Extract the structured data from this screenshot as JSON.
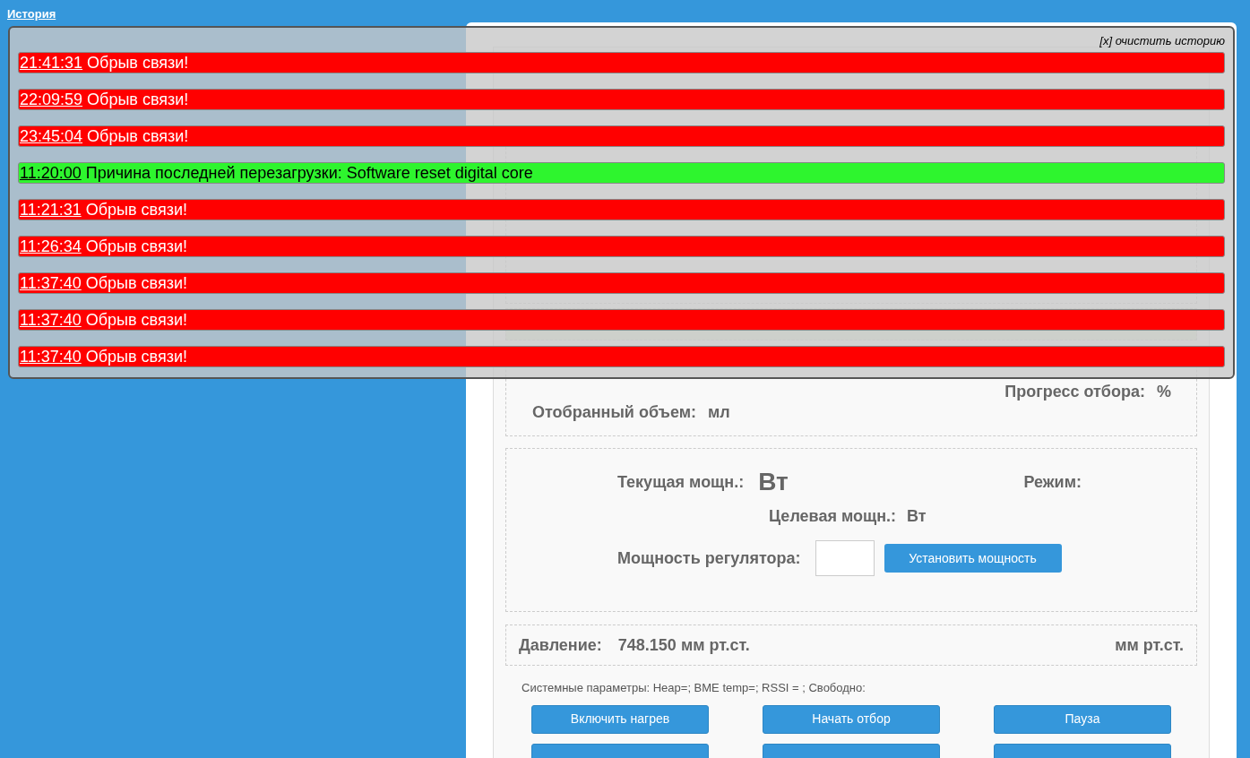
{
  "history_link": "История",
  "history": {
    "clear_link": "[x] очистить историю",
    "entries": [
      {
        "time": "21:41:31",
        "message": "Обрыв связи!",
        "kind": "error"
      },
      {
        "time": "22:09:59",
        "message": "Обрыв связи!",
        "kind": "error"
      },
      {
        "time": "23:45:04",
        "message": "Обрыв связи!",
        "kind": "error"
      },
      {
        "time": "11:20:00",
        "message": "Причина последней перезагрузки: Software reset digital core",
        "kind": "info"
      },
      {
        "time": "11:21:31",
        "message": "Обрыв связи!",
        "kind": "error"
      },
      {
        "time": "11:26:34",
        "message": "Обрыв связи!",
        "kind": "error"
      },
      {
        "time": "11:37:40",
        "message": "Обрыв связи!",
        "kind": "error"
      },
      {
        "time": "11:37:40",
        "message": "Обрыв связи!",
        "kind": "error"
      },
      {
        "time": "11:37:40",
        "message": "Обрыв связи!",
        "kind": "error"
      }
    ]
  },
  "collection": {
    "progress_label": "Прогресс отбора:",
    "progress_unit": "%",
    "volume_label": "Отобранный объем:",
    "volume_unit": "мл"
  },
  "power": {
    "current_label": "Текущая мощн.:",
    "current_unit": "Вт",
    "mode_label": "Режим:",
    "target_label": "Целевая мощн.:",
    "target_unit": "Вт",
    "regulator_label": "Мощность регулятора:",
    "set_button": "Установить мощность"
  },
  "pressure": {
    "label": "Давление:",
    "value": "748.150 мм рт.ст.",
    "right_value": "мм рт.ст."
  },
  "system_params": "Системные параметры: Heap=; BME temp=; RSSI = ; Свободно:",
  "buttons": [
    "Включить нагрев",
    "Начать отбор",
    "Пауза"
  ],
  "cut_buttons": [
    {
      "kind": "button"
    },
    {
      "kind": "button"
    },
    {
      "kind": "button"
    }
  ]
}
